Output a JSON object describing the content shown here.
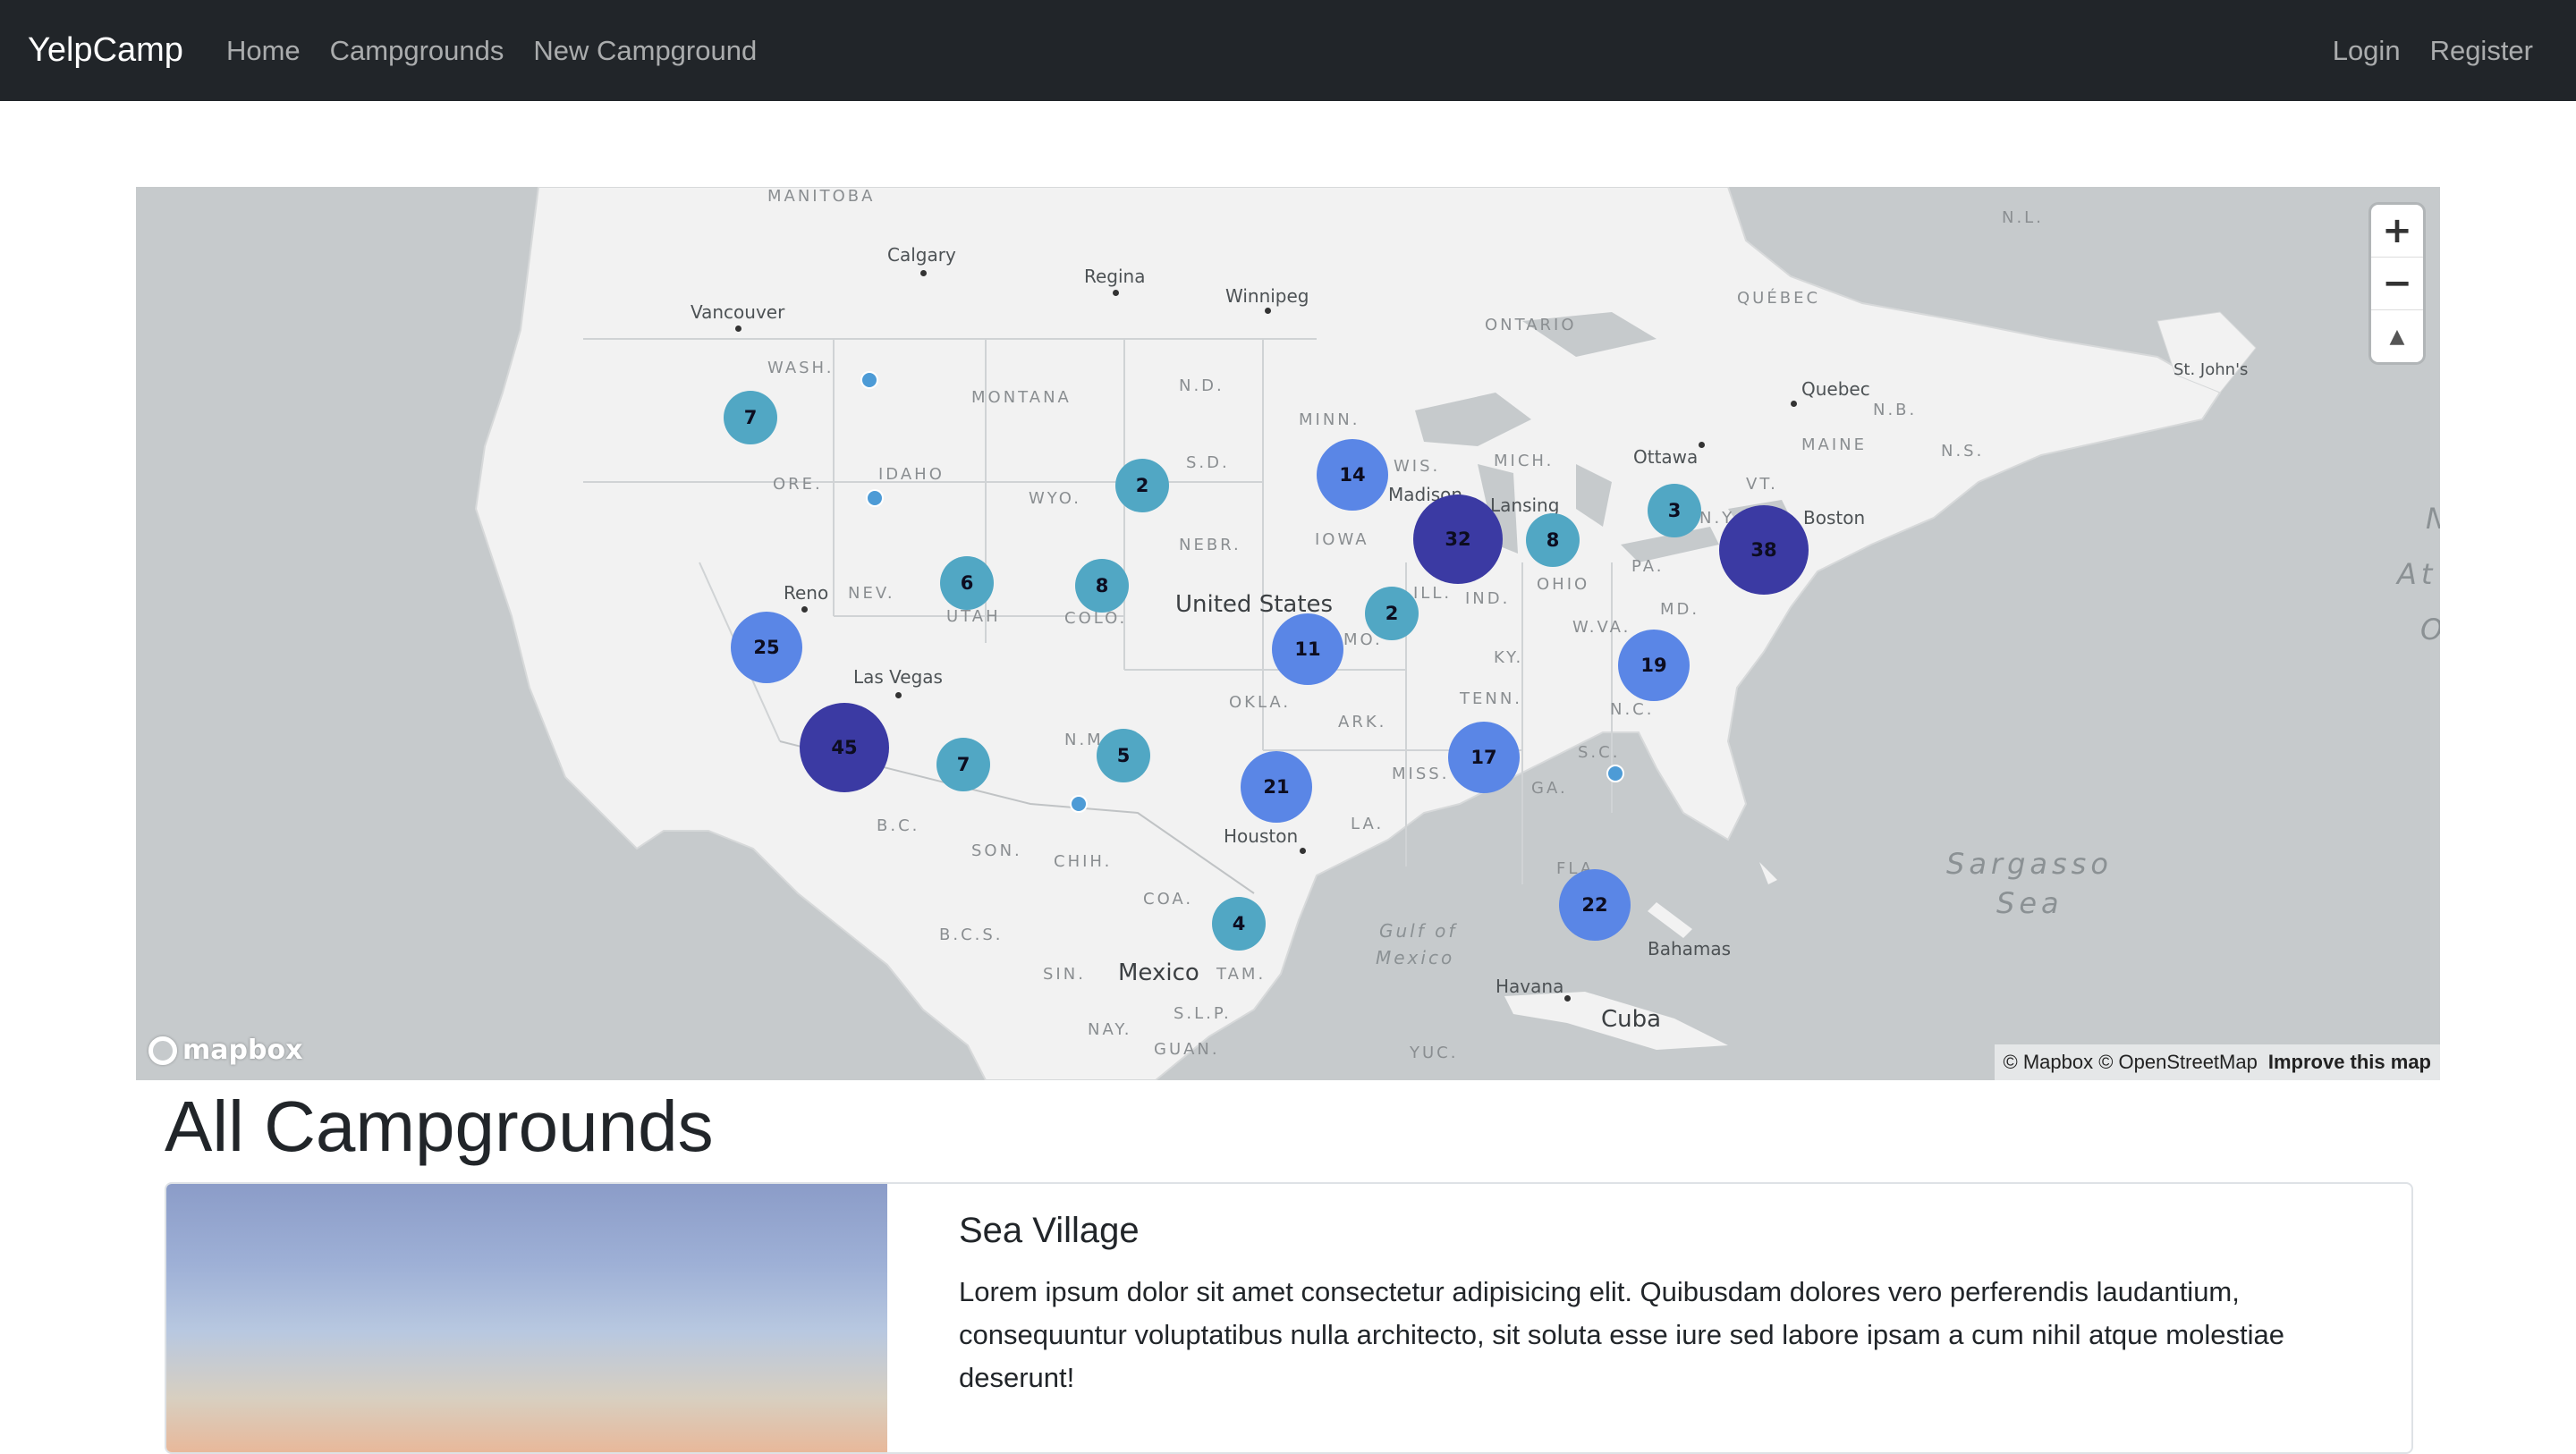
{
  "navbar": {
    "brand": "YelpCamp",
    "links": [
      "Home",
      "Campgrounds",
      "New Campground"
    ],
    "right_links": [
      "Login",
      "Register"
    ]
  },
  "map": {
    "state_labels": [
      "WASH.",
      "MONTANA",
      "N.D.",
      "MINN.",
      "ORE.",
      "IDAHO",
      "WYO.",
      "S.D.",
      "WIS.",
      "MICH.",
      "NEBR.",
      "IOWA",
      "NEV.",
      "UTAH",
      "COLO.",
      "ILL.",
      "IND.",
      "OHIO",
      "PA.",
      "N.Y.",
      "VT.",
      "MAINE",
      "MO.",
      "KY.",
      "W.VA.",
      "MD.",
      "N.C.",
      "TENN.",
      "OKLA.",
      "ARK.",
      "S.C.",
      "N.M.",
      "MISS.",
      "GA.",
      "LA.",
      "FLA.",
      "B.C.",
      "SON.",
      "CHIH.",
      "COA.",
      "B.C.S.",
      "SIN.",
      "TAM.",
      "S.L.P.",
      "NAY.",
      "GUAN.",
      "YUC.",
      "MANITOBA",
      "ONTARIO",
      "QUÉBEC",
      "N.L.",
      "N.B.",
      "N.S."
    ],
    "city_labels": [
      "Calgary",
      "Regina",
      "Winnipeg",
      "Vancouver",
      "Madison",
      "Lansing",
      "Ottawa",
      "Quebec",
      "St. John's",
      "Boston",
      "Reno",
      "Las Vegas",
      "Houston",
      "Havana",
      "Bahamas"
    ],
    "country_labels": [
      "United States",
      "Mexico",
      "Cuba"
    ],
    "sea_labels": [
      "Sargasso",
      "Sea",
      "N",
      "At",
      "O"
    ],
    "gulf_labels": [
      "Gulf of",
      "Mexico"
    ],
    "clusters": [
      7,
      2,
      14,
      6,
      8,
      32,
      8,
      3,
      38,
      25,
      2,
      11,
      19,
      45,
      7,
      5,
      21,
      17,
      4,
      22
    ],
    "controls": {
      "zoom_in": "+",
      "zoom_out": "−",
      "compass": "▲"
    },
    "logo": "mapbox",
    "attribution": "© Mapbox © OpenStreetMap",
    "improve_link": "Improve this map"
  },
  "page": {
    "title": "All Campgrounds"
  },
  "campgrounds": [
    {
      "title": "Sea Village",
      "description": "Lorem ipsum dolor sit amet consectetur adipisicing elit. Quibusdam dolores vero perferendis laudantium, consequuntur voluptatibus nulla architecto, sit soluta esse iure sed labore ipsam a cum nihil atque molestiae deserunt!"
    }
  ],
  "colors": {
    "navbar_bg": "#212529",
    "map_water": "#c6cacc",
    "map_land": "#f2f2f2",
    "cluster_small": "#51a7c4",
    "cluster_medium": "#5a86e6",
    "cluster_large": "#3b3aa3"
  }
}
